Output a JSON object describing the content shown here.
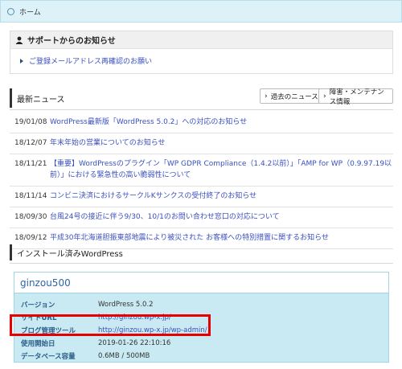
{
  "breadcrumb": {
    "home_label": "ホーム"
  },
  "support": {
    "title": "サポートからのお知らせ",
    "items": [
      {
        "label": "ご登録メールアドレス再確認のお願い"
      }
    ]
  },
  "news": {
    "title": "最新ニュース",
    "past_news_button": "過去のニュース",
    "maintenance_button": "障害・メンテナンス情報",
    "items": [
      {
        "date": "19/01/08",
        "text": "WordPress最新版「WordPress 5.0.2」への対応のお知らせ"
      },
      {
        "date": "18/12/07",
        "text": "年末年始の営業についてのお知らせ"
      },
      {
        "date": "18/11/21",
        "text": "【重要】WordPressのプラグイン「WP GDPR Compliance（1.4.2以前）」「AMP for WP（0.9.97.19以前）」における緊急性の高い脆弱性について"
      },
      {
        "date": "18/11/14",
        "text": "コンビニ決済におけるサークルKサンクスの受付終了のお知らせ"
      },
      {
        "date": "18/09/30",
        "text": "台風24号の接近に伴う9/30、10/1のお問い合わせ窓口の対応について"
      },
      {
        "date": "18/09/12",
        "text": "平成30年北海道胆振東部地震により被災された お客様への特別措置に関するお知らせ"
      }
    ]
  },
  "installed": {
    "title": "インストール済みWordPress",
    "site": {
      "name": "ginzou500",
      "rows": [
        {
          "key": "バージョン",
          "value": "WordPress 5.0.2"
        },
        {
          "key": "サイトURL",
          "value": "http://ginzou.wp-x.jp/"
        },
        {
          "key": "ブログ管理ツール",
          "value": "http://ginzou.wp-x.jp/wp-admin/"
        },
        {
          "key": "使用開始日",
          "value": "2019-01-26 22:10:16"
        },
        {
          "key": "データベース容量",
          "value": "0.6MB / 500MB"
        }
      ]
    }
  },
  "colors": {
    "accent": "#3a4fc0",
    "highlight": "#e60000",
    "site_bg": "#c9eaf3"
  }
}
